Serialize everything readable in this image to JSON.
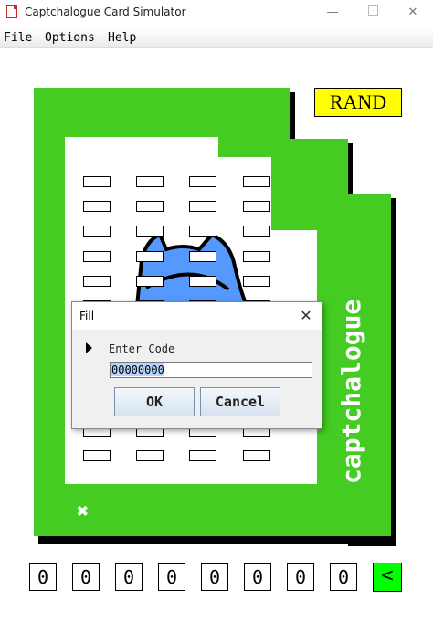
{
  "window": {
    "title": "Captchalogue Card Simulator",
    "minimize_glyph": "—",
    "close_glyph": "✕"
  },
  "menu": {
    "items": [
      "File",
      "Options",
      "Help"
    ]
  },
  "card": {
    "rand_label": "RAND",
    "brand_text": "captchalogue",
    "corner_mark": "✖",
    "colors": {
      "card_green": "#44cc22",
      "rand_yellow": "#ffff00",
      "shadow": "#000000",
      "monster_blue": "#5599ff"
    }
  },
  "code_digits": [
    "0",
    "0",
    "0",
    "0",
    "0",
    "0",
    "0",
    "0"
  ],
  "back_button": "<",
  "dialog": {
    "title": "Fill",
    "close_glyph": "✕",
    "prompt": "Enter Code",
    "input_value": "00000000",
    "ok_label": "OK",
    "cancel_label": "Cancel"
  }
}
